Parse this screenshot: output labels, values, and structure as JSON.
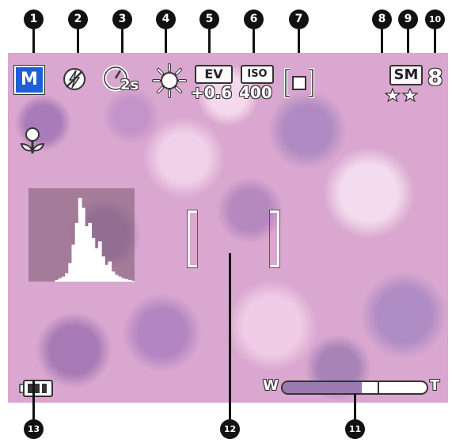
{
  "callouts_top": [
    "1",
    "2",
    "3",
    "4",
    "5",
    "6",
    "7",
    "8",
    "9",
    "10"
  ],
  "callouts_bottom": [
    "13",
    "12",
    "11"
  ],
  "screen": {
    "mode_label": "M",
    "self_timer_delay": "2s",
    "ev_label": "EV",
    "ev_value": "+0.6",
    "iso_label": "ISO",
    "iso_value": "400",
    "resolution_label": "SM",
    "shots_remaining": "8",
    "zoom_wide_label": "W",
    "zoom_tele_label": "T",
    "zoom_level": 0.55,
    "histogram": [
      0,
      0,
      0,
      0,
      0,
      0,
      0,
      0,
      2,
      4,
      6,
      10,
      22,
      44,
      70,
      100,
      88,
      66,
      70,
      52,
      40,
      48,
      30,
      20,
      24,
      12,
      8,
      6,
      4,
      3,
      2,
      1
    ],
    "colors": {
      "mode_bg": "#1e5fd6",
      "battery": "#333333"
    }
  },
  "icons": {
    "mode": "camera-mode-icon",
    "flash": "flash-off-icon",
    "self_timer": "self-timer-icon",
    "white_balance": "sun-icon",
    "metering": "metering-icon",
    "macro": "flower-macro-icon",
    "quality": "star-icon",
    "battery": "battery-icon"
  }
}
